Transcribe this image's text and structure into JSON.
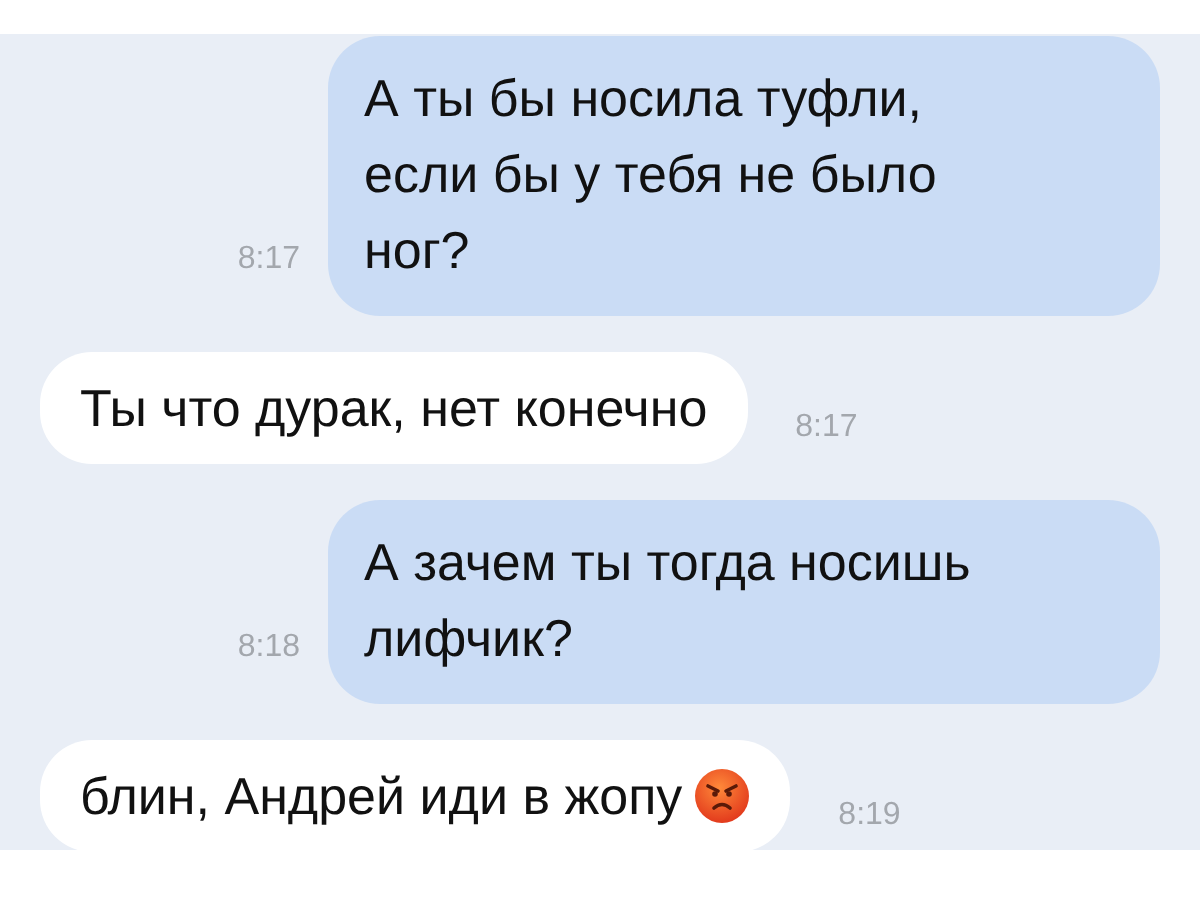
{
  "messages": [
    {
      "kind": "sent",
      "text": "А ты бы носила туфли, если бы у тебя не было ног?",
      "time": "8:17"
    },
    {
      "kind": "received",
      "text": "Ты что дурак, нет конечно",
      "time": "8:17"
    },
    {
      "kind": "sent",
      "text": "А зачем ты тогда носишь лифчик?",
      "time": "8:18"
    },
    {
      "kind": "received",
      "text": "блин, Андрей иди в жопу",
      "time": "8:19",
      "emoji": true
    }
  ]
}
